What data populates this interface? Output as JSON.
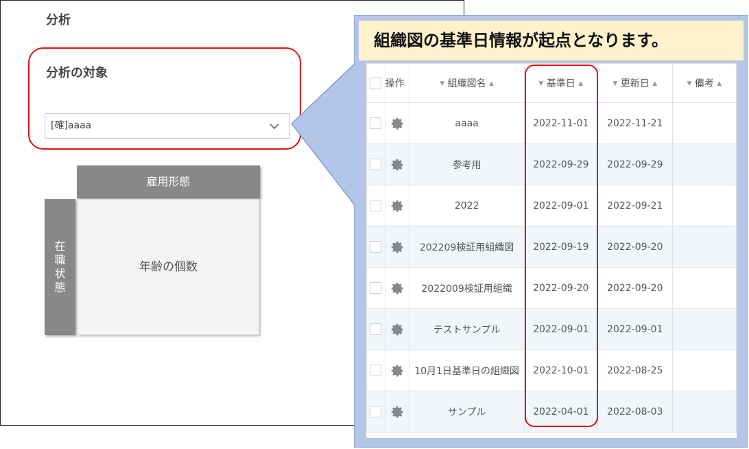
{
  "panel": {
    "title": "分析",
    "target_label": "分析の対象",
    "select_value": "[確]aaaa",
    "col_header": "雇用形態",
    "row_header": [
      "在",
      "職",
      "状",
      "態"
    ],
    "cell_label": "年齢の個数"
  },
  "callout": {
    "banner": "組織図の基準日情報が起点となります。"
  },
  "table": {
    "columns": [
      "操作",
      "組織図名",
      "基準日",
      "更新日",
      "備考"
    ],
    "rows": [
      {
        "name": "aaaa",
        "base_date": "2022-11-01",
        "updated": "2022-11-21",
        "note": ""
      },
      {
        "name": "参考用",
        "base_date": "2022-09-29",
        "updated": "2022-09-29",
        "note": ""
      },
      {
        "name": "2022",
        "base_date": "2022-09-01",
        "updated": "2022-09-21",
        "note": ""
      },
      {
        "name": "202209検証用組織図",
        "base_date": "2022-09-19",
        "updated": "2022-09-20",
        "note": ""
      },
      {
        "name": "2022009検証用組織",
        "base_date": "2022-09-20",
        "updated": "2022-09-20",
        "note": ""
      },
      {
        "name": "テストサンプル",
        "base_date": "2022-09-01",
        "updated": "2022-09-01",
        "note": ""
      },
      {
        "name": "10月1日基準日の組織図",
        "base_date": "2022-10-01",
        "updated": "2022-08-25",
        "note": ""
      },
      {
        "name": "サンプル",
        "base_date": "2022-04-01",
        "updated": "2022-08-03",
        "note": ""
      }
    ]
  },
  "colors": {
    "highlight": "#dd1111",
    "header_gray": "#888888",
    "callout_blue": "#b4c6e7",
    "banner_yellow": "#fff2cc"
  }
}
